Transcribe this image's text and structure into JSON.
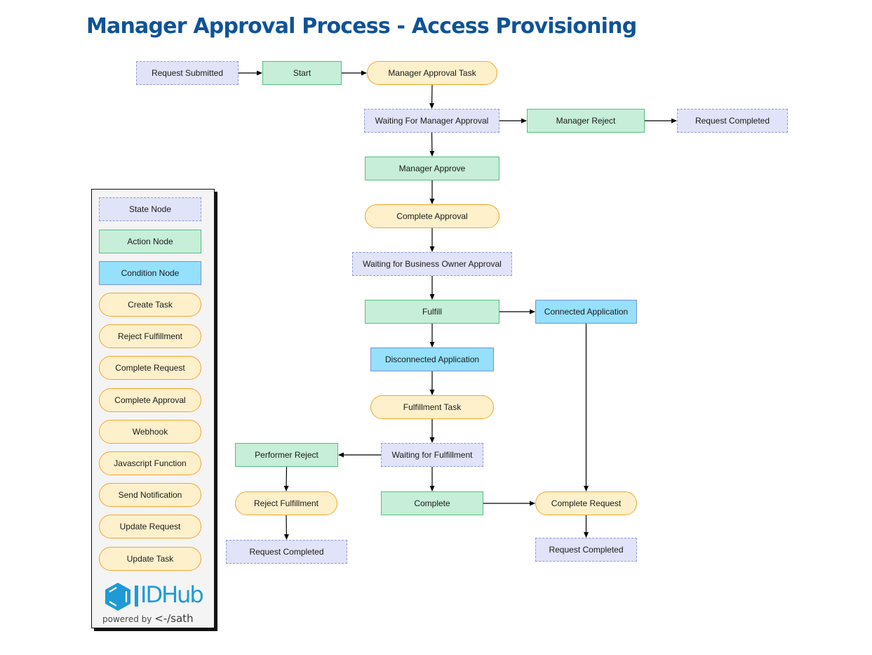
{
  "title": "Manager Approval Process - Access Provisioning",
  "colors": {
    "title": "#0f5396",
    "state_fill": "#e1e3f8",
    "state_border": "#8e9ad8",
    "action_fill": "#c6eed8",
    "action_border": "#54c07e",
    "condition_fill": "#95e0fd",
    "condition_border": "#7f8fd6",
    "task_fill": "#fff0cc",
    "task_border": "#f2a62a",
    "edge": "#000000",
    "logo": "#1e9ad6"
  },
  "nodes": [
    {
      "id": "request-submitted",
      "type": "state",
      "label": "Request Submitted"
    },
    {
      "id": "start",
      "type": "action",
      "label": "Start"
    },
    {
      "id": "manager-approval-task",
      "type": "task",
      "label": "Manager Approval Task"
    },
    {
      "id": "waiting-for-manager-approval",
      "type": "state",
      "label": "Waiting For Manager Approval"
    },
    {
      "id": "manager-reject",
      "type": "action",
      "label": "Manager Reject"
    },
    {
      "id": "request-completed-1",
      "type": "state",
      "label": "Request Completed"
    },
    {
      "id": "manager-approve",
      "type": "action",
      "label": "Manager Approve"
    },
    {
      "id": "complete-approval",
      "type": "task",
      "label": "Complete Approval"
    },
    {
      "id": "waiting-for-business-owner-approval",
      "type": "state",
      "label": "Waiting for Business Owner Approval"
    },
    {
      "id": "fulfill",
      "type": "action",
      "label": "Fulfill"
    },
    {
      "id": "connected-application",
      "type": "condition",
      "label": "Connected Application"
    },
    {
      "id": "disconnected-application",
      "type": "condition",
      "label": "Disconnected Application"
    },
    {
      "id": "fulfillment-task",
      "type": "task",
      "label": "Fulfillment Task"
    },
    {
      "id": "waiting-for-fulfillment",
      "type": "state",
      "label": "Waiting for Fulfillment"
    },
    {
      "id": "performer-reject",
      "type": "action",
      "label": "Performer Reject"
    },
    {
      "id": "reject-fulfillment",
      "type": "task",
      "label": "Reject Fulfillment"
    },
    {
      "id": "request-completed-2",
      "type": "state",
      "label": "Request Completed"
    },
    {
      "id": "complete",
      "type": "action",
      "label": "Complete"
    },
    {
      "id": "complete-request",
      "type": "task",
      "label": "Complete Request"
    },
    {
      "id": "request-completed-3",
      "type": "state",
      "label": "Request Completed"
    }
  ],
  "edges": [
    {
      "from": "request-submitted",
      "to": "start"
    },
    {
      "from": "start",
      "to": "manager-approval-task"
    },
    {
      "from": "manager-approval-task",
      "to": "waiting-for-manager-approval"
    },
    {
      "from": "waiting-for-manager-approval",
      "to": "manager-reject"
    },
    {
      "from": "manager-reject",
      "to": "request-completed-1"
    },
    {
      "from": "waiting-for-manager-approval",
      "to": "manager-approve"
    },
    {
      "from": "manager-approve",
      "to": "complete-approval"
    },
    {
      "from": "complete-approval",
      "to": "waiting-for-business-owner-approval"
    },
    {
      "from": "waiting-for-business-owner-approval",
      "to": "fulfill"
    },
    {
      "from": "fulfill",
      "to": "connected-application"
    },
    {
      "from": "fulfill",
      "to": "disconnected-application"
    },
    {
      "from": "disconnected-application",
      "to": "fulfillment-task"
    },
    {
      "from": "fulfillment-task",
      "to": "waiting-for-fulfillment"
    },
    {
      "from": "waiting-for-fulfillment",
      "to": "performer-reject"
    },
    {
      "from": "performer-reject",
      "to": "reject-fulfillment"
    },
    {
      "from": "reject-fulfillment",
      "to": "request-completed-2"
    },
    {
      "from": "waiting-for-fulfillment",
      "to": "complete"
    },
    {
      "from": "complete",
      "to": "complete-request"
    },
    {
      "from": "connected-application",
      "to": "complete-request"
    },
    {
      "from": "complete-request",
      "to": "request-completed-3"
    }
  ],
  "legend": {
    "items": [
      {
        "type": "state",
        "label": "State Node"
      },
      {
        "type": "action",
        "label": "Action Node"
      },
      {
        "type": "condition",
        "label": "Condition Node"
      },
      {
        "type": "task",
        "label": "Create Task"
      },
      {
        "type": "task",
        "label": "Reject Fulfillment"
      },
      {
        "type": "task",
        "label": "Complete Request"
      },
      {
        "type": "task",
        "label": "Complete Approval"
      },
      {
        "type": "task",
        "label": "Webhook"
      },
      {
        "type": "task",
        "label": "Javascript Function"
      },
      {
        "type": "task",
        "label": "Send Notification"
      },
      {
        "type": "task",
        "label": "Update Request"
      },
      {
        "type": "task",
        "label": "Update Task"
      }
    ]
  },
  "logo": {
    "brand_id": "ID",
    "brand_hub": "Hub",
    "powered_by": "powered by",
    "company": "sath",
    "company_mark": "<-/"
  }
}
